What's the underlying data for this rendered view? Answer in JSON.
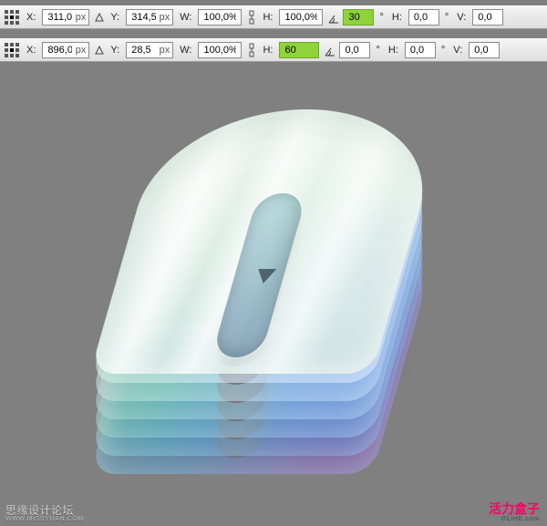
{
  "row1": {
    "x_label": "X:",
    "x_value": "311,0",
    "x_unit": "px",
    "y_label": "Y:",
    "y_value": "314,5",
    "y_unit": "px",
    "w_label": "W:",
    "w_value": "100,0%",
    "h_label": "H:",
    "h_value": "100,0%",
    "angle_label": "",
    "angle_value": "30",
    "angle_hl": true,
    "hskew_label": "H:",
    "hskew_value": "0,0",
    "vskew_label": "V:",
    "vskew_value": "0,0"
  },
  "row2": {
    "x_label": "X:",
    "x_value": "896,0",
    "x_unit": "px",
    "y_label": "Y:",
    "y_value": "28,5",
    "y_unit": "px",
    "w_label": "W:",
    "w_value": "100,0%",
    "h_label": "H:",
    "h_value": "60",
    "h_hl": true,
    "angle_label": "",
    "angle_value": "0,0",
    "hskew_label": "H:",
    "hskew_value": "0,0",
    "vskew_label": "V:",
    "vskew_value": "0,0"
  },
  "watermarks": {
    "left_main": "思缘设计论坛",
    "left_sub": "WWW.MISSYUAN.COM",
    "right_main": "活力盒子",
    "right_sub": "OLiHE.com"
  }
}
